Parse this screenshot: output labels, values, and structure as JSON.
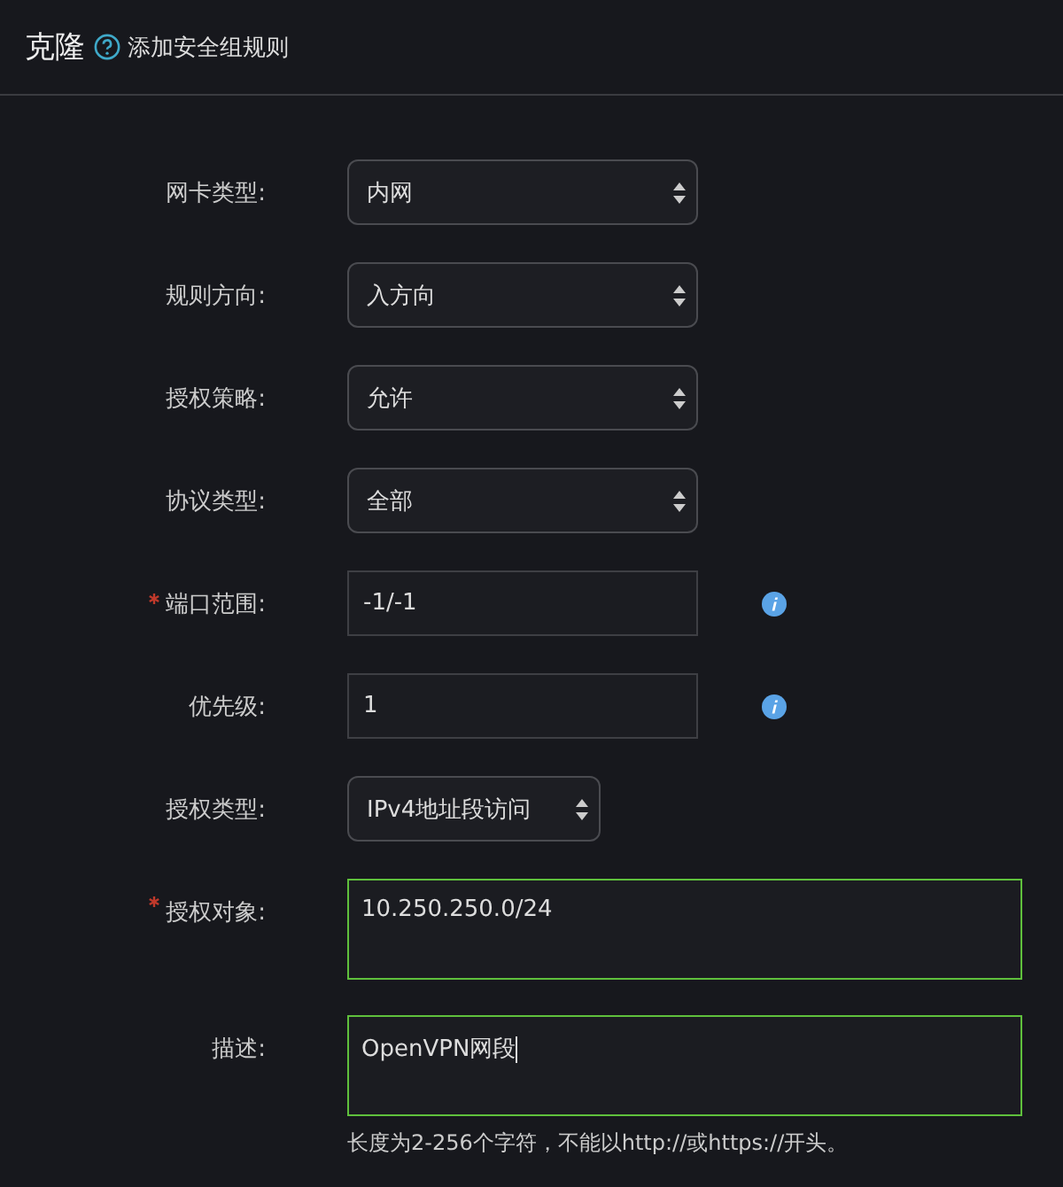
{
  "header": {
    "title": "克隆",
    "subtitle": "添加安全组规则"
  },
  "fields": [
    {
      "label": "网卡类型:",
      "kind": "select",
      "required": false,
      "value": "内网",
      "info": false,
      "compact": false,
      "valid": false,
      "focused": false
    },
    {
      "label": "规则方向:",
      "kind": "select",
      "required": false,
      "value": "入方向",
      "info": false,
      "compact": false,
      "valid": false,
      "focused": false
    },
    {
      "label": "授权策略:",
      "kind": "select",
      "required": false,
      "value": "允许",
      "info": false,
      "compact": false,
      "valid": false,
      "focused": false
    },
    {
      "label": "协议类型:",
      "kind": "select",
      "required": false,
      "value": "全部",
      "info": false,
      "compact": false,
      "valid": false,
      "focused": false
    },
    {
      "label": "端口范围:",
      "kind": "input",
      "required": true,
      "value": "-1/-1",
      "info": true,
      "compact": false,
      "valid": false,
      "focused": false
    },
    {
      "label": "优先级:",
      "kind": "input",
      "required": false,
      "value": "1",
      "info": true,
      "compact": false,
      "valid": false,
      "focused": false
    },
    {
      "label": "授权类型:",
      "kind": "select",
      "required": false,
      "value": "IPv4地址段访问",
      "info": false,
      "compact": true,
      "valid": false,
      "focused": false
    },
    {
      "label": "授权对象:",
      "kind": "textarea",
      "required": true,
      "value": "10.250.250.0/24",
      "info": false,
      "compact": false,
      "valid": true,
      "focused": false
    },
    {
      "label": "描述:",
      "kind": "textarea",
      "required": false,
      "value": "OpenVPN网段",
      "info": false,
      "compact": false,
      "valid": true,
      "focused": true,
      "hint": "长度为2-256个字符，不能以http://或https://开头。"
    }
  ]
}
